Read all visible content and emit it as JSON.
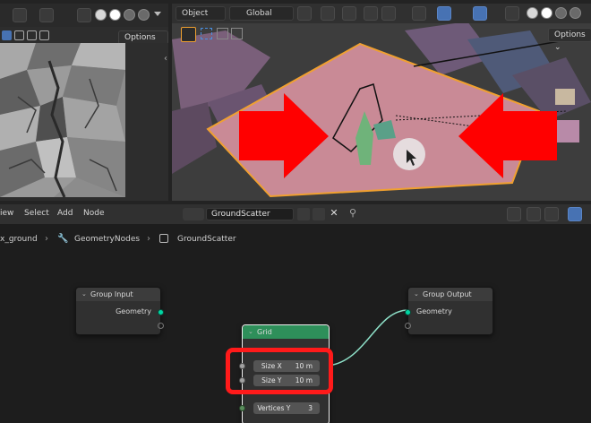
{
  "left_viewport": {
    "options_label": "Options",
    "options_caret": "⌄"
  },
  "viewport3d": {
    "mode_label": "Object",
    "orientation_label": "Global",
    "options_label": "Options",
    "options_caret": "⌄"
  },
  "node_editor": {
    "menus": [
      "iew",
      "Select",
      "Add",
      "Node"
    ],
    "tree_name": "GroundScatter",
    "breadcrumb": [
      "x_ground",
      "GeometryNodes",
      "GroundScatter"
    ],
    "nodes": {
      "group_input": {
        "title": "Group Input",
        "outputs": [
          "Geometry"
        ]
      },
      "group_output": {
        "title": "Group Output",
        "inputs": [
          "Geometry"
        ]
      },
      "grid": {
        "title": "Grid",
        "fields": [
          {
            "label": "Size X",
            "value": "10 m"
          },
          {
            "label": "Size Y",
            "value": "10 m"
          },
          {
            "label": "Vertices Y",
            "value": "3"
          }
        ]
      }
    }
  },
  "annotations": {
    "highlight_color": "#ff1a1a",
    "arrow_color": "#ff0000"
  },
  "colors": {
    "accent_blue": "#4772b3",
    "geometry_socket": "#00d6a3",
    "grid_node_header": "#2e8f5a",
    "selection_orange": "#f0a030",
    "selected_face_pink": "#c98a96"
  }
}
